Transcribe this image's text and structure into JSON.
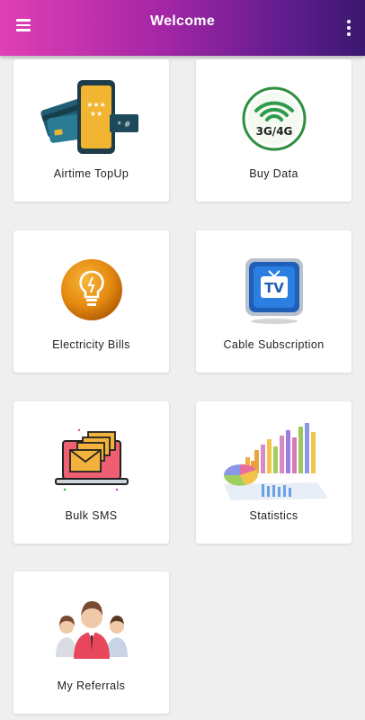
{
  "header": {
    "title": "Welcome",
    "menu_icon": "hamburger-menu-icon",
    "more_icon": "more-vertical-icon"
  },
  "services": [
    {
      "label": "Airtime TopUp",
      "icon": "phone-card-icon"
    },
    {
      "label": "Buy Data",
      "icon": "wifi-3g-4g-icon",
      "badge": "3G/4G"
    },
    {
      "label": "Electricity Bills",
      "icon": "light-bulb-icon"
    },
    {
      "label": "Cable Subscription",
      "icon": "tv-icon",
      "badge": "TV"
    },
    {
      "label": "Bulk SMS",
      "icon": "envelopes-laptop-icon"
    },
    {
      "label": "Statistics",
      "icon": "statistics-chart-icon"
    },
    {
      "label": "My Referrals",
      "icon": "people-group-icon"
    }
  ],
  "colors": {
    "header_start": "#e13fb4",
    "header_end": "#3a1870",
    "background": "#efefef"
  }
}
